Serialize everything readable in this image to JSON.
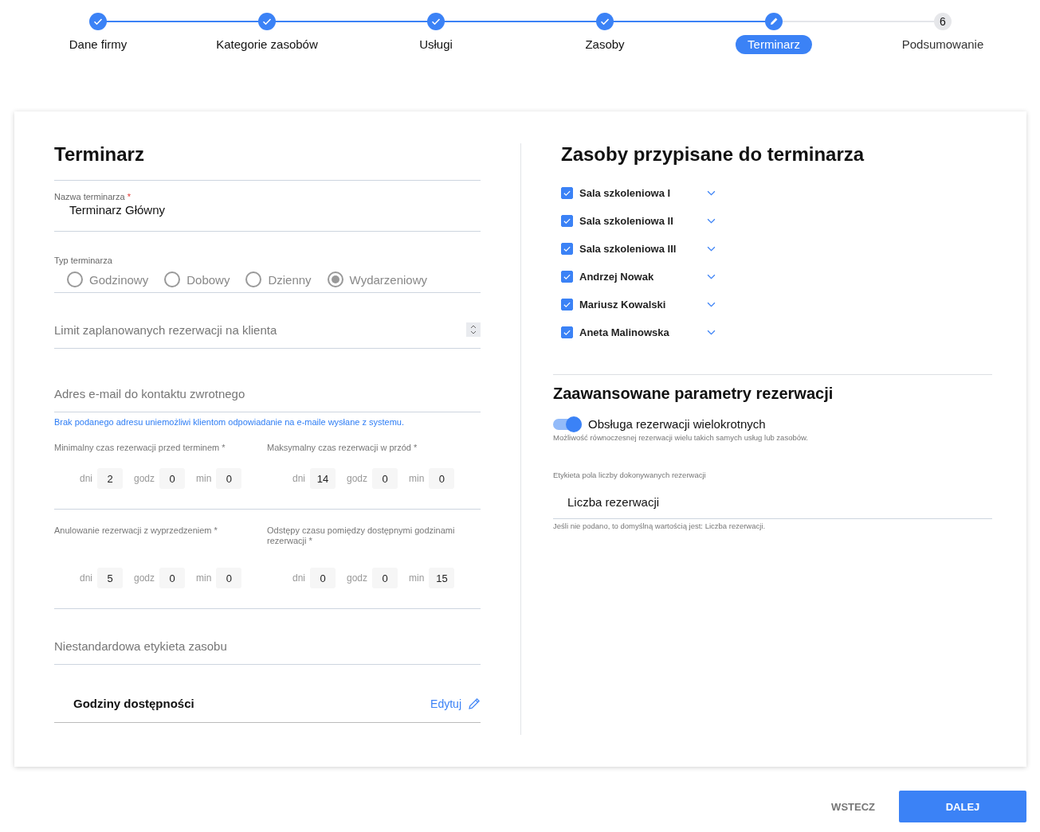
{
  "stepper": [
    {
      "label": "Dane firmy",
      "done": true,
      "selected": false
    },
    {
      "label": "Kategorie zasobów",
      "done": true,
      "selected": false
    },
    {
      "label": "Usługi",
      "done": true,
      "selected": false
    },
    {
      "label": "Zasoby",
      "done": true,
      "selected": false
    },
    {
      "label": "Terminarz",
      "done": false,
      "selected": true
    },
    {
      "label": "Podsumowanie",
      "done": false,
      "selected": false,
      "number": "6"
    }
  ],
  "left": {
    "title": "Terminarz",
    "name_field": {
      "label": "Nazwa terminarza",
      "required_mark": "*",
      "value": "Terminarz Główny"
    },
    "type_field": {
      "label": "Typ terminarza",
      "disabled": true,
      "options": [
        {
          "label": "Godzinowy",
          "selected": false
        },
        {
          "label": "Dobowy",
          "selected": false
        },
        {
          "label": "Dzienny",
          "selected": false
        },
        {
          "label": "Wydarzeniowy",
          "selected": true
        }
      ]
    },
    "limit_field": {
      "placeholder": "Limit zaplanowanych rezerwacji na klienta"
    },
    "email_field": {
      "placeholder": "Adres e-mail do kontaktu zwrotnego",
      "hint": "Brak podanego adresu uniemożliwi klientom odpowiadanie na e-maile wysłane z systemu."
    },
    "durations": [
      {
        "label": "Minimalny czas rezerwacji przed terminem *",
        "units": [
          {
            "unit": "dni",
            "value": "2"
          },
          {
            "unit": "godz",
            "value": "0"
          },
          {
            "unit": "min",
            "value": "0"
          }
        ]
      },
      {
        "label": "Maksymalny czas rezerwacji w przód *",
        "units": [
          {
            "unit": "dni",
            "value": "14"
          },
          {
            "unit": "godz",
            "value": "0"
          },
          {
            "unit": "min",
            "value": "0"
          }
        ]
      },
      {
        "label": "Anulowanie rezerwacji z wyprzedzeniem *",
        "units": [
          {
            "unit": "dni",
            "value": "5"
          },
          {
            "unit": "godz",
            "value": "0"
          },
          {
            "unit": "min",
            "value": "0"
          }
        ]
      },
      {
        "label": "Odstępy czasu pomiędzy dostępnymi godzinami rezerwacji *",
        "units": [
          {
            "unit": "dni",
            "value": "0"
          },
          {
            "unit": "godz",
            "value": "0"
          },
          {
            "unit": "min",
            "value": "15"
          }
        ]
      }
    ],
    "label_field": {
      "placeholder": "Niestandardowa etykieta zasobu"
    },
    "hours": {
      "title": "Godziny dostępności",
      "action": "Edytuj"
    }
  },
  "right": {
    "title": "Zasoby przypisane do terminarza",
    "resources": [
      {
        "name": "Sala szkoleniowa I",
        "checked": true
      },
      {
        "name": "Sala szkoleniowa II",
        "checked": true
      },
      {
        "name": "Sala szkoleniowa III",
        "checked": true
      },
      {
        "name": "Andrzej Nowak",
        "checked": true
      },
      {
        "name": "Mariusz Kowalski",
        "checked": true
      },
      {
        "name": "Aneta Malinowska",
        "checked": true
      }
    ],
    "advanced_title": "Zaawansowane parametry rezerwacji",
    "toggle": {
      "label": "Obsługa rezerwacji wielokrotnych",
      "on": true,
      "description": "Możliwość równoczesnej rezerwacji wielu takich samych usług lub zasobów."
    },
    "count_field": {
      "label": "Etykieta pola liczby dokonywanych rezerwacji",
      "value": "Liczba rezerwacji",
      "hint": "Jeśli nie podano, to domyślną wartością jest: Liczba rezerwacji."
    }
  },
  "buttons": {
    "back": "WSTECZ",
    "next": "DALEJ"
  }
}
